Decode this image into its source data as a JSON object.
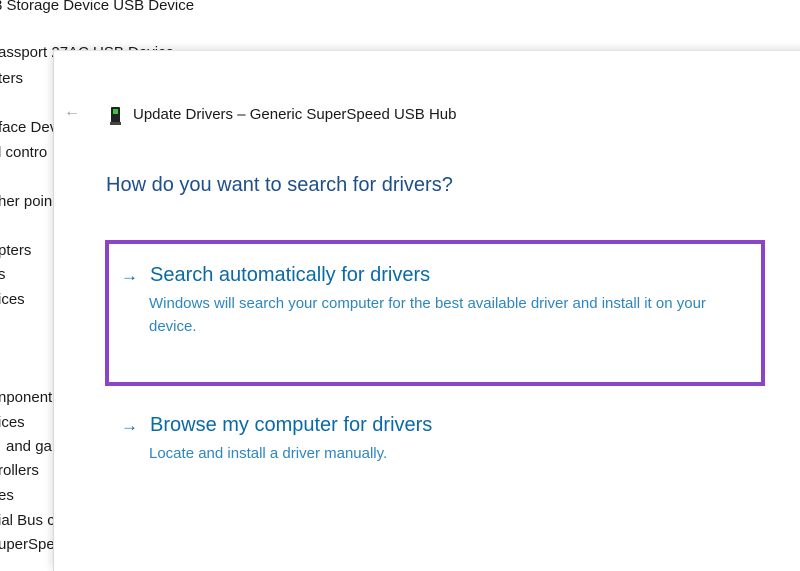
{
  "background_list": [
    "3 Storage Device USB Device",
    "assport 27AC USB Device",
    "ters",
    "face Dev",
    "l contro",
    "her poin",
    "pters",
    "s",
    "ices",
    "nponent",
    "ices",
    "and ga",
    "rollers",
    "es",
    "ial Bus c",
    "uperSpe"
  ],
  "dialog": {
    "back_icon": "arrow-left-icon",
    "device_icon": "usb-hub-icon",
    "title": "Update Drivers – Generic SuperSpeed USB Hub",
    "heading": "How do you want to search for drivers?",
    "options": [
      {
        "arrow": "→",
        "title": "Search automatically for drivers",
        "description": "Windows will search your computer for the best available driver and install it on your device.",
        "highlighted": true
      },
      {
        "arrow": "→",
        "title": "Browse my computer for drivers",
        "description": "Locate and install a driver manually.",
        "highlighted": false
      }
    ]
  },
  "colors": {
    "highlight": "#8b45c8",
    "link": "#0a6aa8",
    "heading": "#1d4f8c"
  }
}
